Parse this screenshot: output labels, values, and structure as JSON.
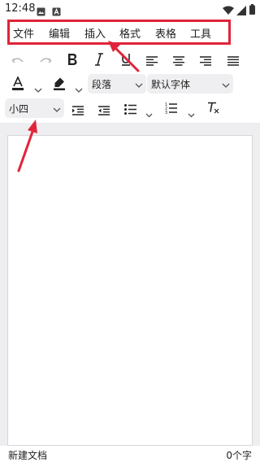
{
  "status_bar": {
    "time": "12:48"
  },
  "menu": {
    "items": [
      {
        "label": "文件"
      },
      {
        "label": "编辑"
      },
      {
        "label": "插入"
      },
      {
        "label": "格式"
      },
      {
        "label": "表格"
      },
      {
        "label": "工具"
      }
    ]
  },
  "toolbar": {
    "paragraph_select": {
      "value": "段落"
    },
    "font_family_select": {
      "value": "默认字体"
    },
    "font_size_select": {
      "value": "小四"
    },
    "text_color": "#222222",
    "highlight_color": "#222222"
  },
  "annotations": {
    "color": "#e0243a"
  },
  "footer": {
    "doc_name": "新建文档",
    "word_count": "0个字"
  }
}
